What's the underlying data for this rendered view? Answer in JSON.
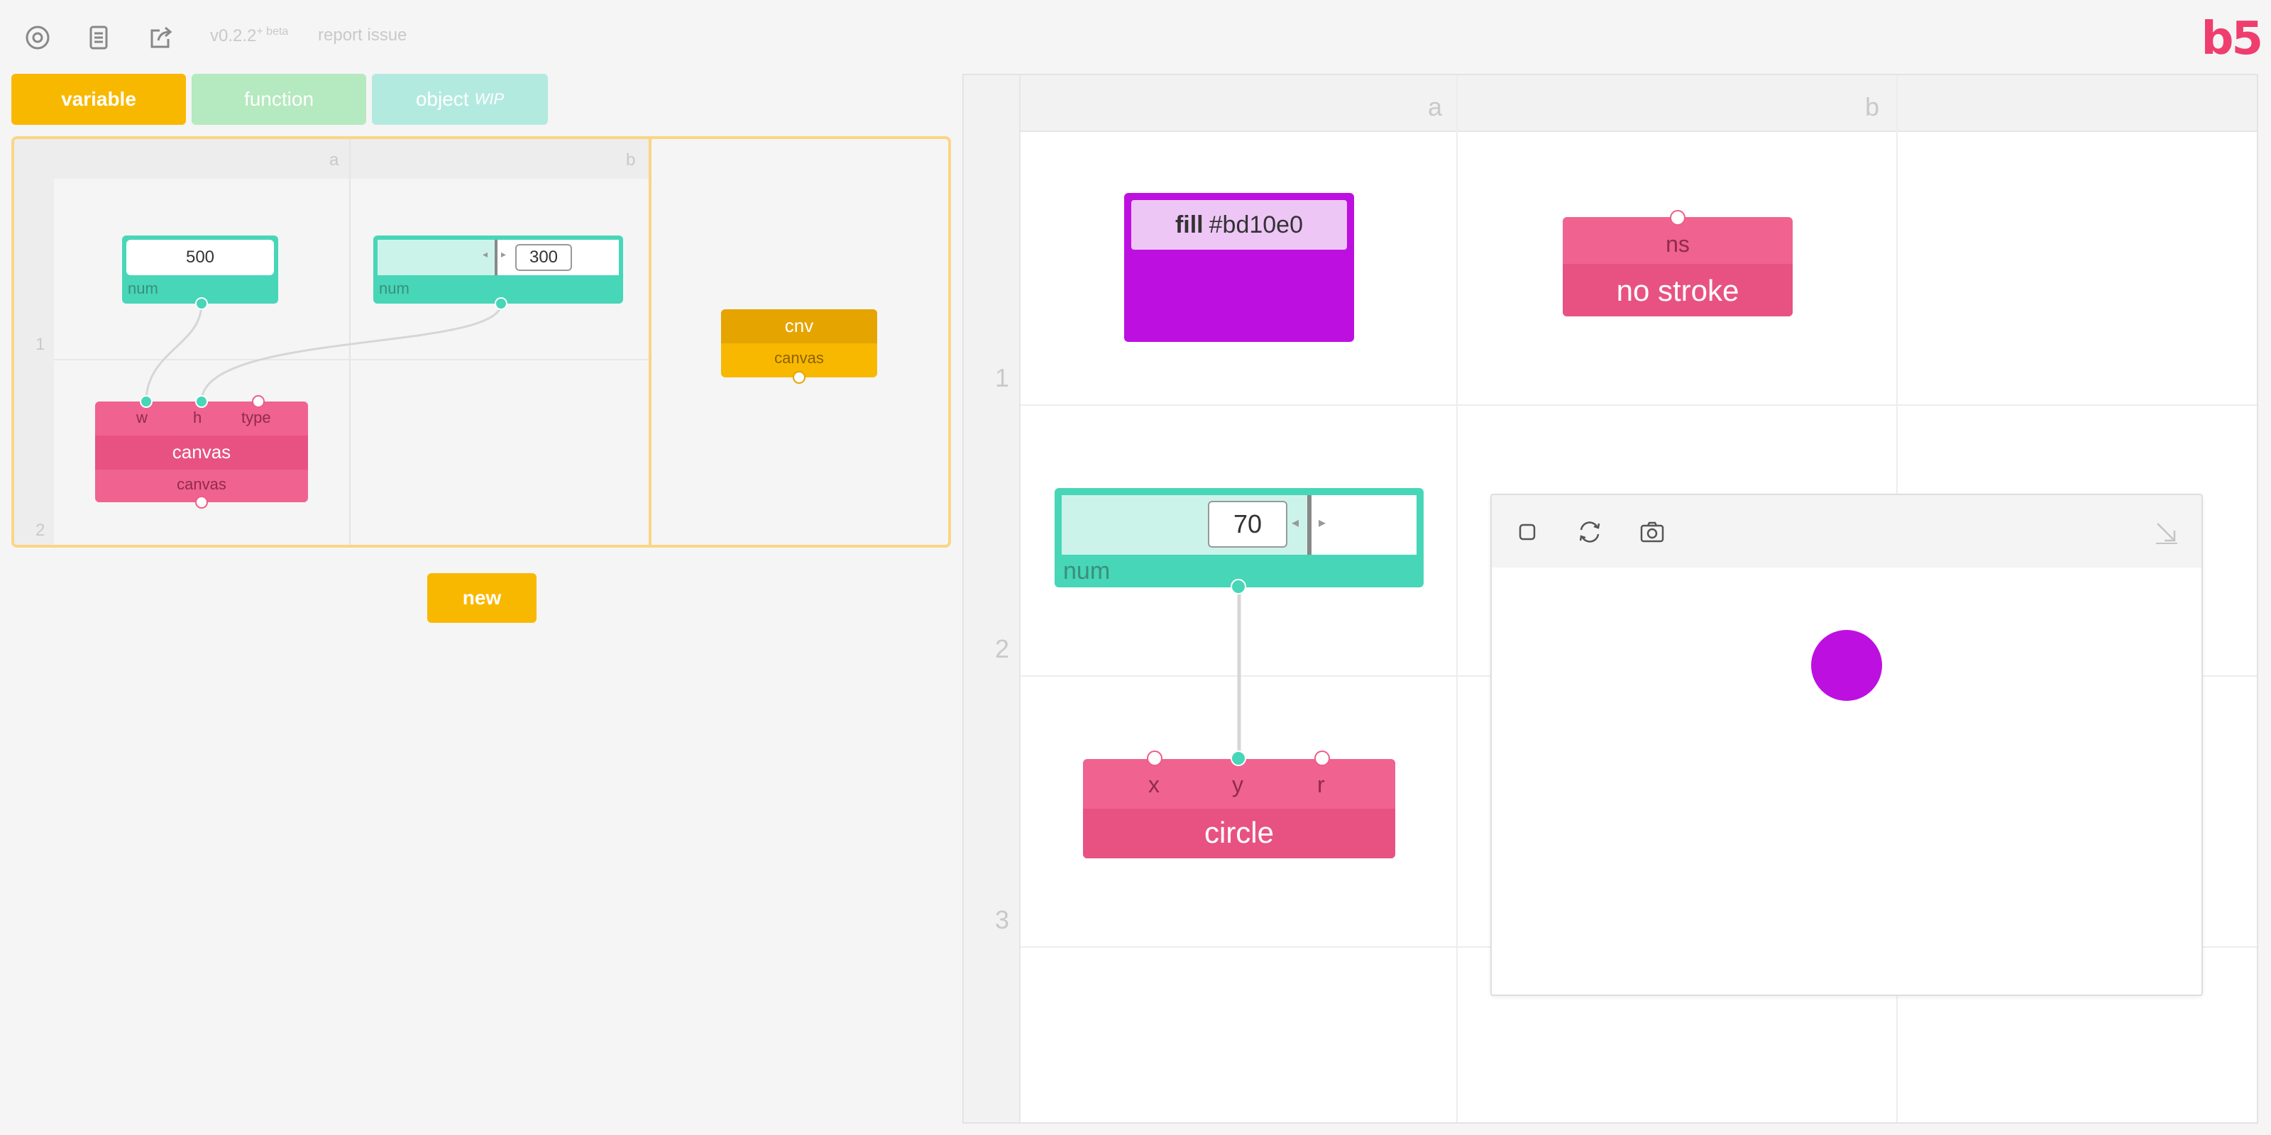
{
  "topbar": {
    "settings_icon": "gear-icon",
    "docs_icon": "document-icon",
    "share_icon": "share-icon",
    "version": "v0.2.2",
    "version_suffix": "+ beta",
    "report_issue": "report issue",
    "logo": "b5"
  },
  "tabs": {
    "variable": "variable",
    "function": "function",
    "object": "object",
    "object_tag": "WIP"
  },
  "colors": {
    "variable": "#f9b800",
    "function": "#b5e9bf",
    "object": "#b3eae0",
    "teal": "#47d6b7",
    "pink": "#f06290",
    "fill": "#bd10e0"
  },
  "library": {
    "col_a": "a",
    "col_b": "b",
    "row_1": "1",
    "row_2": "2",
    "num_a_value": "500",
    "num_a_label": "num",
    "num_b_value": "300",
    "num_b_label": "num",
    "canvas_ports": [
      "w",
      "h",
      "type"
    ],
    "canvas_title": "canvas",
    "canvas_output": "canvas",
    "cnv_title": "cnv",
    "cnv_output": "canvas",
    "new_button": "new"
  },
  "editor": {
    "col_a": "a",
    "col_b": "b",
    "row_1": "1",
    "row_2": "2",
    "row_3": "3",
    "fill_keyword": "fill",
    "fill_value": "#bd10e0",
    "ns_title": "ns",
    "ns_label": "no stroke",
    "num_value": "70",
    "num_label": "num",
    "circle_ports": [
      "x",
      "y",
      "r"
    ],
    "circle_label": "circle"
  },
  "preview": {
    "stop_icon": "square-icon",
    "reload_icon": "refresh-icon",
    "camera_icon": "camera-icon",
    "resize_icon": "resize-arrow-icon",
    "circle_color": "#bd10e0"
  }
}
